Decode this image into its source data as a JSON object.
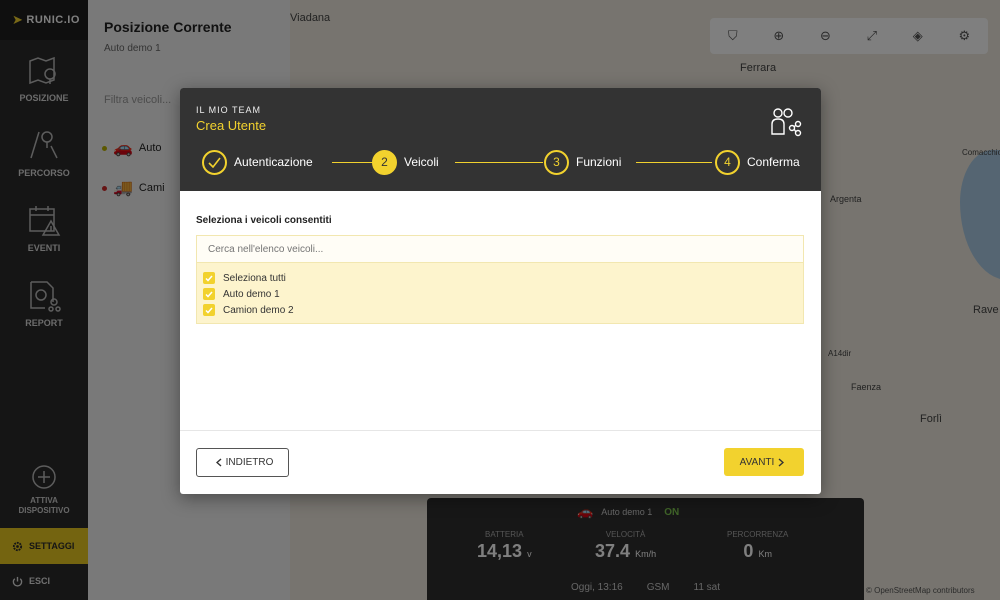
{
  "app": {
    "logo_text": "RUNIC.IO"
  },
  "sidebar": {
    "items": [
      {
        "label": "POSIZIONE",
        "icon": "map-pin-icon"
      },
      {
        "label": "PERCORSO",
        "icon": "route-icon"
      },
      {
        "label": "EVENTI",
        "icon": "calendar-alert-icon"
      },
      {
        "label": "REPORT",
        "icon": "report-icon"
      }
    ],
    "activate_label": "ATTIVA DISPOSITIVO",
    "settings_label": "SETTAGGI",
    "logout_label": "ESCI"
  },
  "panel": {
    "title": "Posizione Corrente",
    "subtitle": "Auto demo 1",
    "filter_placeholder": "Filtra veicoli...",
    "vehicles": [
      {
        "name": "Auto",
        "status_color": "#b8b000"
      },
      {
        "name": "Cami",
        "status_color": "#cc2a2a"
      }
    ]
  },
  "map": {
    "cities": [
      "Viadana",
      "Ferrara",
      "Argenta",
      "Faenza",
      "Forlì",
      "Rave",
      "Comacchio"
    ],
    "road_label": "A14dir",
    "toolbar_icons": [
      "location-shield-icon",
      "zoom-in-icon",
      "zoom-out-icon",
      "fullscreen-icon",
      "layers-icon",
      "settings-icon"
    ],
    "copyright": "© OpenStreetMap contributors"
  },
  "status_card": {
    "vehicle": "Auto demo 1",
    "state": "ON",
    "battery_label": "BATTERIA",
    "battery_value": "14,13",
    "battery_unit": "v",
    "speed_label": "VELOCITÀ",
    "speed_value": "37.4",
    "speed_unit": "Km/h",
    "distance_label": "PERCORRENZA",
    "distance_value": "0",
    "distance_unit": "Km",
    "time": "Oggi, 13:16",
    "gsm": "GSM",
    "sat": "11 sat"
  },
  "modal": {
    "kicker": "IL MIO TEAM",
    "title": "Crea Utente",
    "steps": [
      {
        "number": "1",
        "label": "Autenticazione",
        "state": "done"
      },
      {
        "number": "2",
        "label": "Veicoli",
        "state": "active"
      },
      {
        "number": "3",
        "label": "Funzioni",
        "state": "pending"
      },
      {
        "number": "4",
        "label": "Conferma",
        "state": "pending"
      }
    ],
    "section_title": "Seleziona i veicoli consentiti",
    "search_placeholder": "Cerca nell'elenco veicoli...",
    "options": [
      {
        "label": "Seleziona tutti",
        "checked": true
      },
      {
        "label": "Auto demo 1",
        "checked": true
      },
      {
        "label": "Camion demo 2",
        "checked": true
      }
    ],
    "back_label": "INDIETRO",
    "next_label": "AVANTI"
  },
  "colors": {
    "accent": "#f2d22e",
    "header_bg": "#333333",
    "sidebar_bg": "#2b2b2b"
  }
}
